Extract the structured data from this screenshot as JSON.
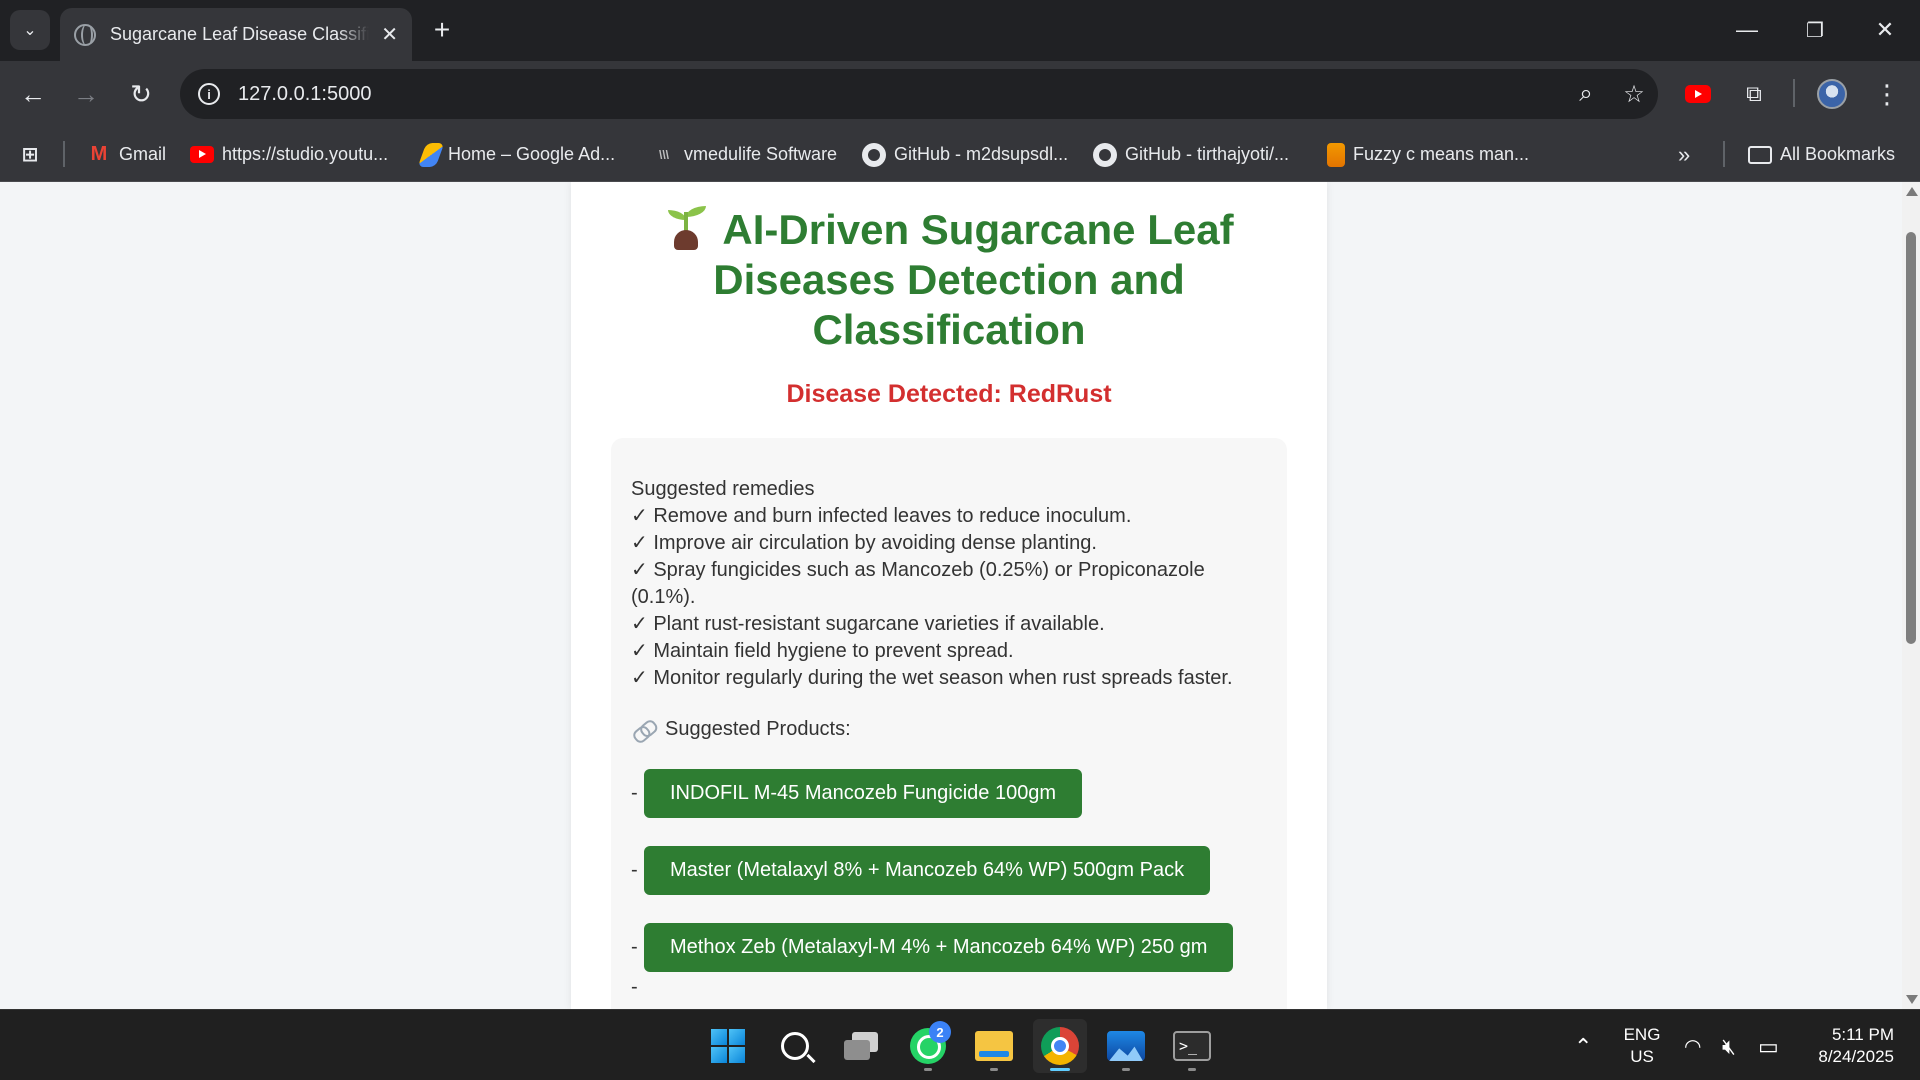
{
  "browser": {
    "tab_title": "Sugarcane Leaf Disease Classification",
    "url": "127.0.0.1:5000",
    "bookmarks": [
      {
        "label": "Gmail"
      },
      {
        "label": "https://studio.youtu..."
      },
      {
        "label": "Home – Google Ad..."
      },
      {
        "label": "vmedulife Software"
      },
      {
        "label": "GitHub - m2dsupsdl..."
      },
      {
        "label": "GitHub - tirthajyoti/..."
      },
      {
        "label": "Fuzzy c means man..."
      }
    ],
    "all_bookmarks": "All Bookmarks"
  },
  "page": {
    "title": "AI-Driven Sugarcane Leaf Diseases Detection and Classification",
    "disease_detected": "Disease Detected: RedRust",
    "remedies_heading": "Suggested remedies",
    "remedies": [
      "✓ Remove and burn infected leaves to reduce inoculum.",
      "✓ Improve air circulation by avoiding dense planting.",
      "✓ Spray fungicides such as Mancozeb (0.25%) or Propiconazole (0.1%).",
      "✓ Plant rust-resistant sugarcane varieties if available.",
      "✓ Maintain field hygiene to prevent spread.",
      "✓ Monitor regularly during the wet season when rust spreads faster."
    ],
    "products_heading": "Suggested Products:",
    "dash": "-",
    "products": [
      {
        "label": "INDOFIL M-45 Mancozeb Fungicide 100gm"
      },
      {
        "label": "Master (Metalaxyl 8% + Mancozeb 64% WP) 500gm Pack"
      },
      {
        "label": "Methox Zeb (Metalaxyl-M 4% + Mancozeb 64% WP) 250 gm"
      }
    ],
    "product_color": "#2e7d32",
    "title_color": "#2e7d32",
    "disease_color": "#d32f2f"
  },
  "taskbar": {
    "whatsapp_badge": "2",
    "lang_line1": "ENG",
    "lang_line2": "US",
    "time": "5:11 PM",
    "date": "8/24/2025"
  }
}
